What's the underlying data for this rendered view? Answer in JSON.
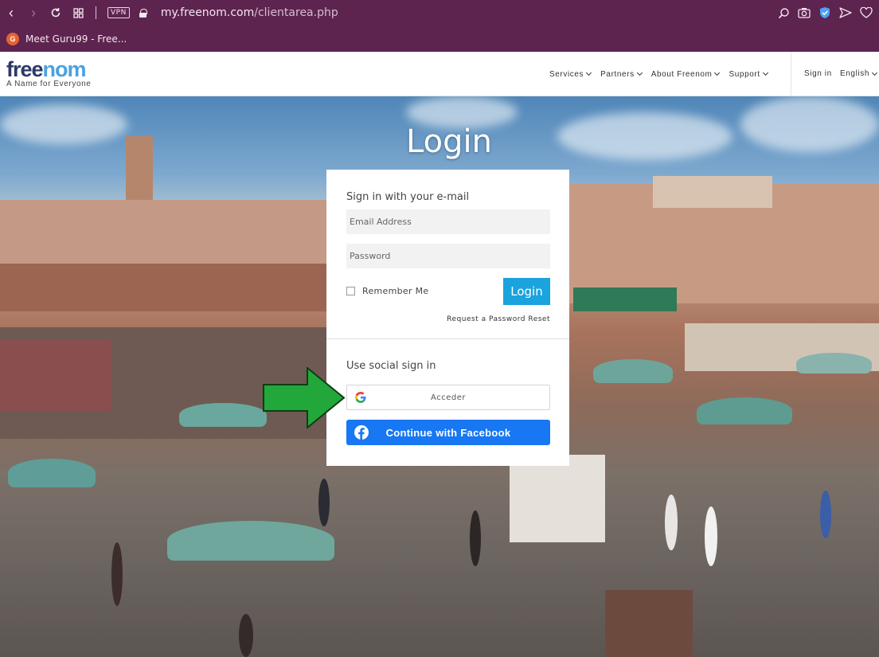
{
  "browser": {
    "vpn_label": "VPN",
    "url_main": "my.freenom.com",
    "url_path": "/clientarea.php",
    "bookmark_label": "Meet Guru99 - Free...",
    "bookmark_favicon": "G"
  },
  "header": {
    "logo_part1": "free",
    "logo_part2": "nom",
    "tagline": "A Name for Everyone",
    "nav": [
      "Services",
      "Partners",
      "About Freenom",
      "Support"
    ],
    "signin": "Sign in",
    "language": "English"
  },
  "page": {
    "title": "Login"
  },
  "login_card": {
    "email_section_title": "Sign in with your e-mail",
    "email_placeholder": "Email Address",
    "password_placeholder": "Password",
    "remember_label": "Remember Me",
    "login_button": "Login",
    "reset_link": "Request a Password Reset",
    "social_section_title": "Use social sign in",
    "google_button": "Acceder",
    "facebook_button": "Continue with Facebook"
  },
  "colors": {
    "browser_bar": "#5e2450",
    "login_button": "#1aa3dd",
    "facebook": "#1877f2",
    "logo_dark": "#2b3a67",
    "logo_light": "#4aa3df",
    "annotation_arrow": "#22a83a"
  },
  "icons": [
    "back-icon",
    "forward-icon",
    "reload-icon",
    "tabs-grid-icon",
    "lock-icon",
    "zoom-icon",
    "camera-icon",
    "shield-icon",
    "send-icon",
    "heart-icon",
    "google-icon",
    "facebook-icon",
    "green-arrow-icon"
  ]
}
